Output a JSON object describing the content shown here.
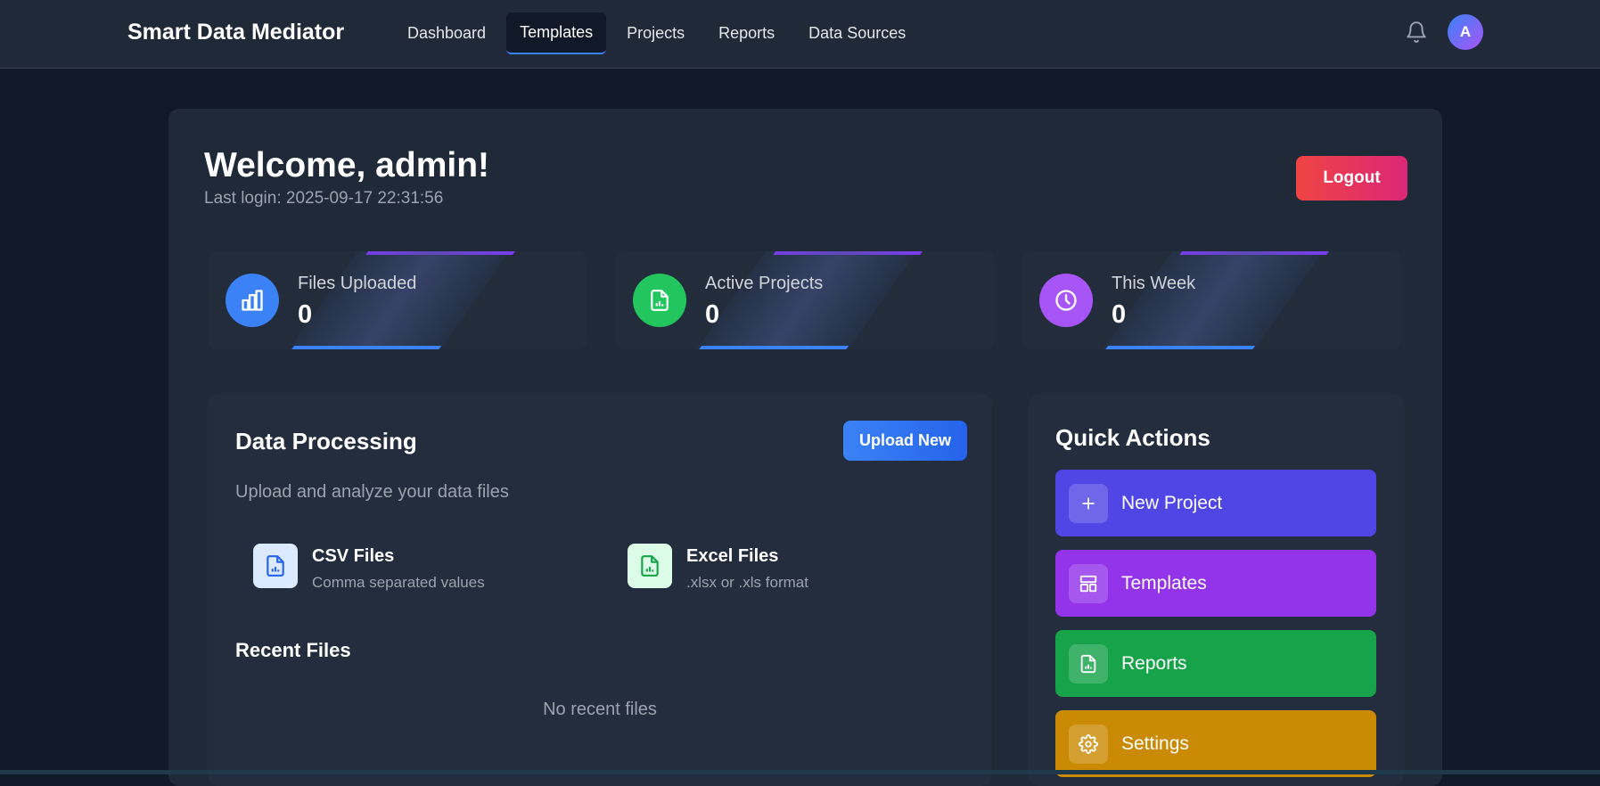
{
  "app": {
    "title": "Smart Data Mediator"
  },
  "nav": {
    "items": [
      {
        "label": "Dashboard"
      },
      {
        "label": "Templates"
      },
      {
        "label": "Projects"
      },
      {
        "label": "Reports"
      },
      {
        "label": "Data Sources"
      }
    ],
    "active": "Templates"
  },
  "user": {
    "avatar_initial": "A",
    "welcome": "Welcome, admin!",
    "last_login": "Last login: 2025-09-17 22:31:56",
    "logout_label": "Logout"
  },
  "stats": [
    {
      "label": "Files Uploaded",
      "value": "0",
      "icon": "bar-chart-icon",
      "color": "#3b82f6"
    },
    {
      "label": "Active Projects",
      "value": "0",
      "icon": "file-chart-icon",
      "color": "#22c55e"
    },
    {
      "label": "This Week",
      "value": "0",
      "icon": "clock-icon",
      "color": "#a855f7"
    }
  ],
  "data_processing": {
    "title": "Data Processing",
    "upload_label": "Upload New",
    "subtitle": "Upload and analyze your data files",
    "file_types": [
      {
        "title": "CSV Files",
        "desc": "Comma separated values",
        "icon": "csv-file-icon",
        "color": "#2563eb"
      },
      {
        "title": "Excel Files",
        "desc": ".xlsx or .xls format",
        "icon": "excel-file-icon",
        "color": "#16a34a"
      }
    ],
    "recent_title": "Recent Files",
    "recent_empty": "No recent files"
  },
  "quick_actions": {
    "title": "Quick Actions",
    "items": [
      {
        "label": "New Project",
        "icon": "plus-icon",
        "color": "#4f46e5"
      },
      {
        "label": "Templates",
        "icon": "template-icon",
        "color": "#9333ea"
      },
      {
        "label": "Reports",
        "icon": "report-icon",
        "color": "#16a34a"
      },
      {
        "label": "Settings",
        "icon": "gear-icon",
        "color": "#ca8a04"
      }
    ]
  }
}
